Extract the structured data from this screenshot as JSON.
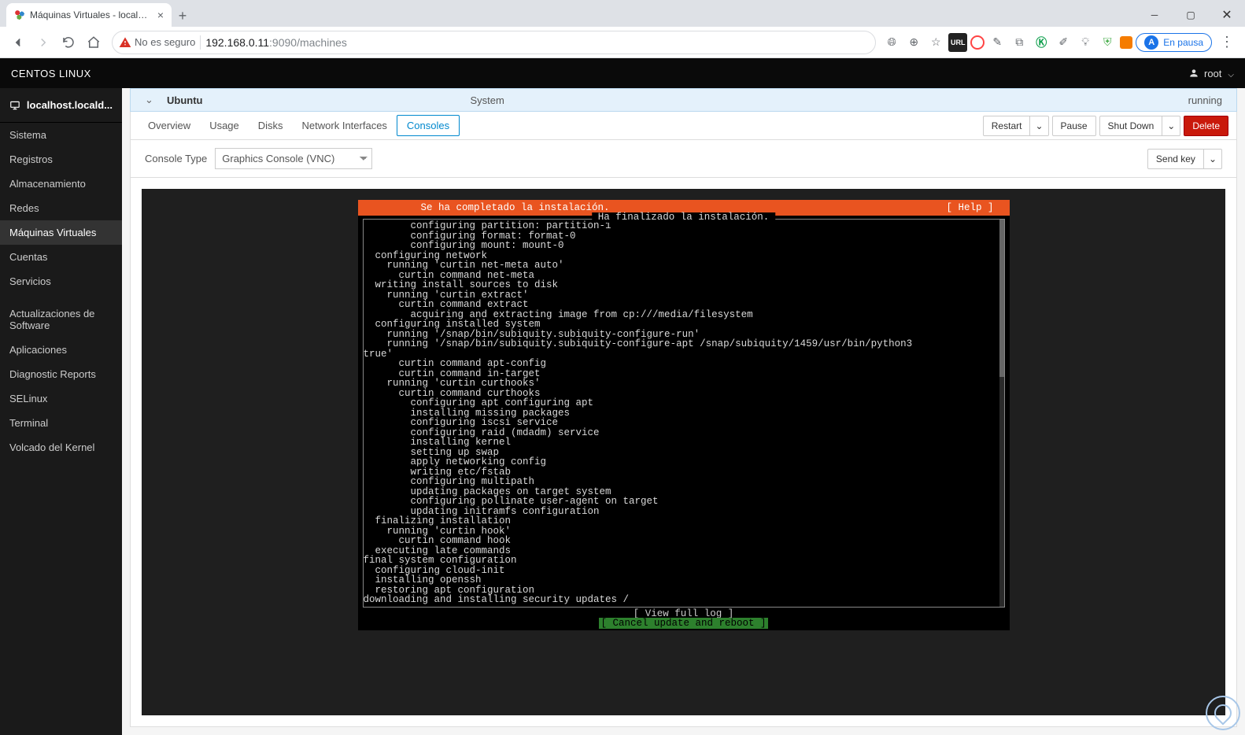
{
  "browser": {
    "tab_title": "Máquinas Virtuales - localhost.lo",
    "security_label": "No es seguro",
    "url_host": "192.168.0.11",
    "url_port": ":9090",
    "url_path": "/machines",
    "profile_label": "En pausa",
    "profile_initial": "A",
    "ext_url_badge": "URL"
  },
  "cockpit": {
    "brand": "CENTOS LINUX",
    "user": "root",
    "host": "localhost.locald...",
    "nav": [
      "Sistema",
      "Registros",
      "Almacenamiento",
      "Redes",
      "Máquinas Virtuales",
      "Cuentas",
      "Servicios",
      "Actualizaciones de Software",
      "Aplicaciones",
      "Diagnostic Reports",
      "SELinux",
      "Terminal",
      "Volcado del Kernel"
    ],
    "nav_active_index": 4
  },
  "vm": {
    "name": "Ubuntu",
    "system": "System",
    "state": "running",
    "tabs": [
      "Overview",
      "Usage",
      "Disks",
      "Network Interfaces",
      "Consoles"
    ],
    "tabs_active_index": 4,
    "actions": {
      "restart": "Restart",
      "pause": "Pause",
      "shutdown": "Shut Down",
      "delete": "Delete"
    },
    "console": {
      "type_label": "Console Type",
      "type_value": "Graphics Console (VNC)",
      "send_key": "Send key"
    }
  },
  "installer": {
    "banner_msg": "Se ha completado la instalación.",
    "banner_help": "[ Help ]",
    "box_title": "Ha finalizado la instalación.",
    "log": "        configuring partition: partition-1\n        configuring format: format-0\n        configuring mount: mount-0\n  configuring network\n    running 'curtin net-meta auto'\n      curtin command net-meta\n  writing install sources to disk\n    running 'curtin extract'\n      curtin command extract\n        acquiring and extracting image from cp:///media/filesystem\n  configuring installed system\n    running '/snap/bin/subiquity.subiquity-configure-run'\n    running '/snap/bin/subiquity.subiquity-configure-apt /snap/subiquity/1459/usr/bin/python3\ntrue'\n      curtin command apt-config\n      curtin command in-target\n    running 'curtin curthooks'\n      curtin command curthooks\n        configuring apt configuring apt\n        installing missing packages\n        configuring iscsi service\n        configuring raid (mdadm) service\n        installing kernel\n        setting up swap\n        apply networking config\n        writing etc/fstab\n        configuring multipath\n        updating packages on target system\n        configuring pollinate user-agent on target\n        updating initramfs configuration\n  finalizing installation\n    running 'curtin hook'\n      curtin command hook\n  executing late commands\nfinal system configuration\n  configuring cloud-init\n  installing openssh\n  restoring apt configuration\ndownloading and installing security updates /",
    "footer_view": "[ View full log       ]",
    "footer_cancel": "[ Cancel update and reboot ]"
  }
}
